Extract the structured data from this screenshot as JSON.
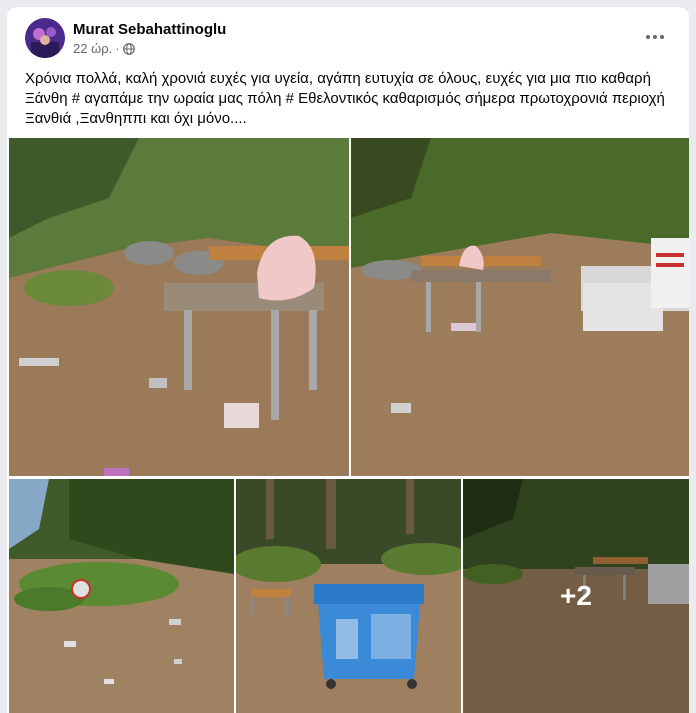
{
  "post": {
    "author": "Murat Sebahattinoglu",
    "time": "22 ώρ.",
    "separator": "·",
    "privacy_icon": "globe-icon",
    "menu_icon": "more-options-icon",
    "text": "Χρόνια πολλά, καλή χρονιά ευχές για υγεία, αγάπη ευτυχία σε όλους, ευχές για μια πιο καθαρή Ξάνθη # αγαπάμε την ωραία μας πόλη # Εθελοντικός καθαρισμός σήμερα πρωτοχρονιά περιοχή Ξανθιά ,Ξανθηππι και όχι μόνο...."
  },
  "photos": {
    "count": 5,
    "more_label": "+2"
  },
  "colors": {
    "background": "#e9ebee",
    "card": "#ffffff",
    "text": "#050505",
    "secondary_text": "#65676b"
  }
}
